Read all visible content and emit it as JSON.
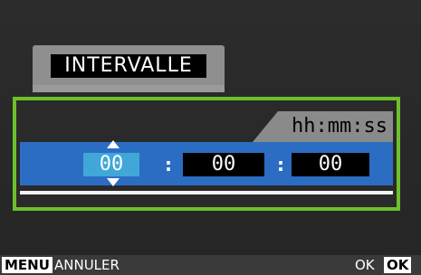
{
  "title": "INTERVALLE",
  "time_format_label": "hh:mm:ss",
  "time": {
    "hours": "00",
    "minutes": "00",
    "seconds": "00",
    "separator": ":"
  },
  "footer": {
    "menu_key": "MENU",
    "menu_action": "ANNULER",
    "ok_action": "OK",
    "ok_key": "OK"
  },
  "colors": {
    "highlight_border": "#6cc02a",
    "band": "#2c6dc4",
    "selected_field": "#41a7d8"
  }
}
